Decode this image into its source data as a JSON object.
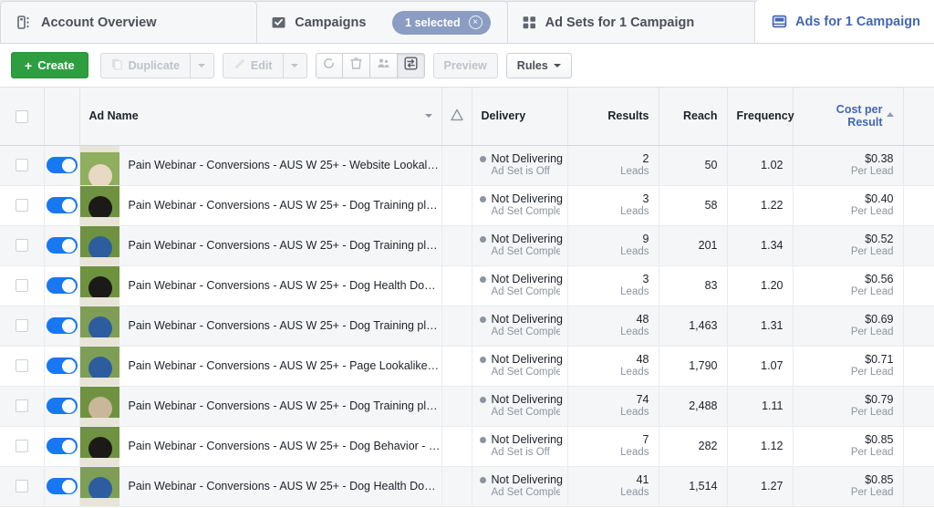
{
  "tabs": [
    {
      "label": "Account Overview",
      "icon": "account-overview-icon",
      "active": false,
      "pill": null
    },
    {
      "label": "Campaigns",
      "icon": "campaigns-clipboard-icon",
      "active": false,
      "pill": {
        "label": "1 selected",
        "close": "×"
      }
    },
    {
      "label": "Ad Sets for 1 Campaign",
      "icon": "ad-sets-grid-icon",
      "active": false,
      "pill": null
    },
    {
      "label": "Ads for 1 Campaign",
      "icon": "ads-window-icon",
      "active": true,
      "pill": null
    }
  ],
  "toolbar": {
    "create_label": "Create",
    "create_plus": "+",
    "duplicate_label": "Duplicate",
    "edit_label": "Edit",
    "preview_label": "Preview",
    "rules_label": "Rules",
    "icons": [
      {
        "name": "refresh-icon",
        "pressed": false
      },
      {
        "name": "trash-icon",
        "pressed": false
      },
      {
        "name": "audience-people-icon",
        "pressed": false
      },
      {
        "name": "ab-test-switch-icon",
        "pressed": true
      }
    ],
    "accent_green": "#2e9e41"
  },
  "table": {
    "columns": {
      "select_all": "",
      "toggle": "",
      "ad_name": "Ad Name",
      "warning": "⚠",
      "delivery": "Delivery",
      "results": "Results",
      "reach": "Reach",
      "frequency": "Frequency",
      "cost_per_result": "Cost per Result"
    },
    "sorted_column": "Cost per Result",
    "sort_direction": "asc",
    "sorted_color": "#4267b2",
    "rows": [
      {
        "ad_name": "Pain Webinar - Conversions - AUS W 25+ - Website Lookalike…",
        "toggle_on": true,
        "delivery_status": "Not Delivering",
        "delivery_note": "Ad Set is Off",
        "results": "2",
        "results_unit": "Leads",
        "reach": "50",
        "frequency": "1.02",
        "cost_per_result": "$0.38",
        "cost_unit": "Per Lead",
        "thumb": {
          "bg": "#8fae5e",
          "subject": "#e8d9c4"
        }
      },
      {
        "ad_name": "Pain Webinar - Conversions - AUS W 25+ - Dog Training plus …",
        "toggle_on": true,
        "delivery_status": "Not Delivering",
        "delivery_note": "Ad Set Complete",
        "results": "3",
        "results_unit": "Leads",
        "reach": "58",
        "frequency": "1.22",
        "cost_per_result": "$0.40",
        "cost_unit": "Per Lead",
        "thumb": {
          "bg": "#6f9240",
          "subject": "#1c1a17"
        }
      },
      {
        "ad_name": "Pain Webinar - Conversions - AUS W 25+ - Dog Training plus …",
        "toggle_on": true,
        "delivery_status": "Not Delivering",
        "delivery_note": "Ad Set Complete",
        "results": "9",
        "results_unit": "Leads",
        "reach": "201",
        "frequency": "1.34",
        "cost_per_result": "$0.52",
        "cost_unit": "Per Lead",
        "thumb": {
          "bg": "#6f9240",
          "subject": "#2d5d9e"
        }
      },
      {
        "ad_name": "Pain Webinar - Conversions - AUS W 25+ - Dog Health Dog …",
        "toggle_on": true,
        "delivery_status": "Not Delivering",
        "delivery_note": "Ad Set Complete",
        "results": "3",
        "results_unit": "Leads",
        "reach": "83",
        "frequency": "1.20",
        "cost_per_result": "$0.56",
        "cost_unit": "Per Lead",
        "thumb": {
          "bg": "#6f9240",
          "subject": "#1c1a17"
        }
      },
      {
        "ad_name": "Pain Webinar - Conversions - AUS W 25+ - Dog Training plus …",
        "toggle_on": true,
        "delivery_status": "Not Delivering",
        "delivery_note": "Ad Set Complete",
        "results": "48",
        "results_unit": "Leads",
        "reach": "1,463",
        "frequency": "1.31",
        "cost_per_result": "$0.69",
        "cost_unit": "Per Lead",
        "thumb": {
          "bg": "#7f9e55",
          "subject": "#2d5d9e"
        }
      },
      {
        "ad_name": "Pain Webinar - Conversions - AUS W 25+ - Page Lookalike D…",
        "toggle_on": true,
        "delivery_status": "Not Delivering",
        "delivery_note": "Ad Set Complete",
        "results": "48",
        "results_unit": "Leads",
        "reach": "1,790",
        "frequency": "1.07",
        "cost_per_result": "$0.71",
        "cost_unit": "Per Lead",
        "thumb": {
          "bg": "#7f9e55",
          "subject": "#2d5d9e"
        }
      },
      {
        "ad_name": "Pain Webinar - Conversions - AUS W 25+ - Dog Training plus …",
        "toggle_on": true,
        "delivery_status": "Not Delivering",
        "delivery_note": "Ad Set Complete",
        "results": "74",
        "results_unit": "Leads",
        "reach": "2,488",
        "frequency": "1.11",
        "cost_per_result": "$0.79",
        "cost_unit": "Per Lead",
        "thumb": {
          "bg": "#6f9240",
          "subject": "#c9b79a"
        }
      },
      {
        "ad_name": "Pain Webinar - Conversions - AUS W 25+ - Dog Behavior - M…",
        "toggle_on": true,
        "delivery_status": "Not Delivering",
        "delivery_note": "Ad Set is Off",
        "results": "7",
        "results_unit": "Leads",
        "reach": "282",
        "frequency": "1.12",
        "cost_per_result": "$0.85",
        "cost_unit": "Per Lead",
        "thumb": {
          "bg": "#6f9240",
          "subject": "#1c1a17"
        }
      },
      {
        "ad_name": "Pain Webinar - Conversions - AUS W 25+ - Dog Health Dog …",
        "toggle_on": true,
        "delivery_status": "Not Delivering",
        "delivery_note": "Ad Set Complete",
        "results": "41",
        "results_unit": "Leads",
        "reach": "1,514",
        "frequency": "1.27",
        "cost_per_result": "$0.85",
        "cost_unit": "Per Lead",
        "thumb": {
          "bg": "#7f9e55",
          "subject": "#2d5d9e"
        }
      }
    ]
  }
}
